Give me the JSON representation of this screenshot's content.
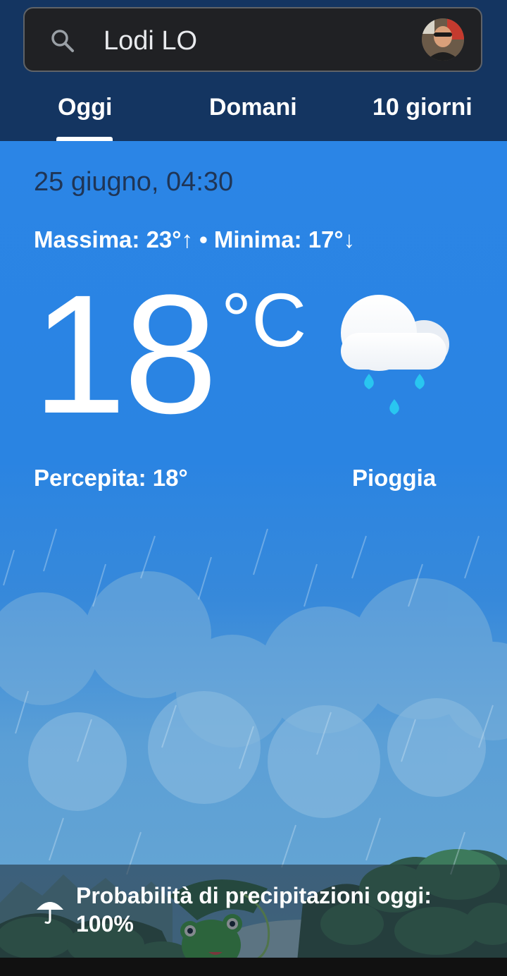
{
  "search": {
    "query": "Lodi LO"
  },
  "tabs": [
    {
      "label": "Oggi"
    },
    {
      "label": "Domani"
    },
    {
      "label": "10 giorni"
    }
  ],
  "weather": {
    "datetime": "25 giugno, 04:30",
    "minmax": "Massima: 23°↑ • Minima: 17°↓",
    "temperature": "18",
    "unit": "°C",
    "feels_like": "Percepita: 18°",
    "condition": "Pioggia",
    "condition_icon": "rain-cloud-icon"
  },
  "precipitation": {
    "text": "Probabilità di precipitazioni oggi: 100%",
    "icon": "umbrella-icon"
  },
  "colors": {
    "header_bg": "#143561",
    "sky_top": "#2b85e6",
    "rain_drop": "#29c6f0"
  }
}
